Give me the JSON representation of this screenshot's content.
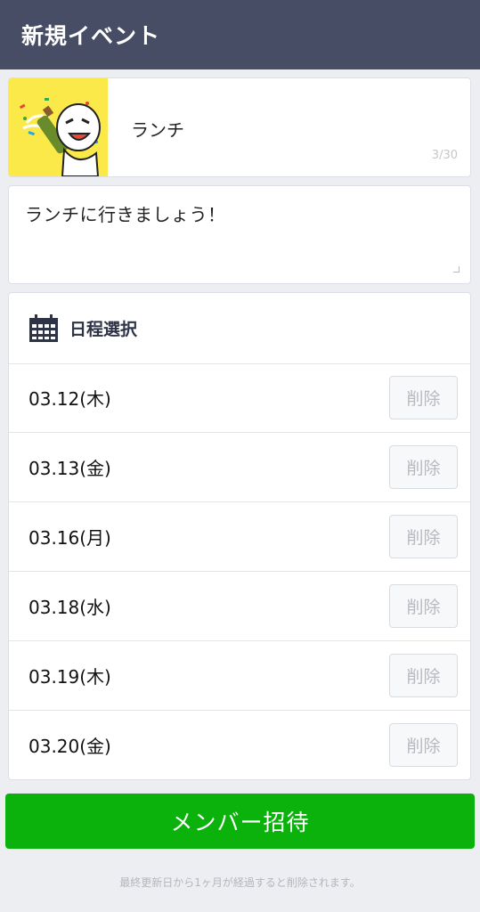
{
  "header": {
    "title": "新規イベント"
  },
  "event": {
    "title": "ランチ",
    "title_counter": "3/30",
    "description": "ランチに行きましょう！"
  },
  "schedule": {
    "heading": "日程選択",
    "icon": "calendar-icon",
    "dates": [
      {
        "date": "03.12(木)",
        "delete_label": "削除"
      },
      {
        "date": "03.13(金)",
        "delete_label": "削除"
      },
      {
        "date": "03.16(月)",
        "delete_label": "削除"
      },
      {
        "date": "03.18(水)",
        "delete_label": "削除"
      },
      {
        "date": "03.19(木)",
        "delete_label": "削除"
      },
      {
        "date": "03.20(金)",
        "delete_label": "削除"
      }
    ]
  },
  "actions": {
    "invite_label": "メンバー招待"
  },
  "footer": {
    "note": "最終更新日から1ヶ月が経過すると削除されます。"
  },
  "colors": {
    "header": "#474d65",
    "accent": "#0bb20c",
    "thumb_bg": "#fbe94a"
  }
}
